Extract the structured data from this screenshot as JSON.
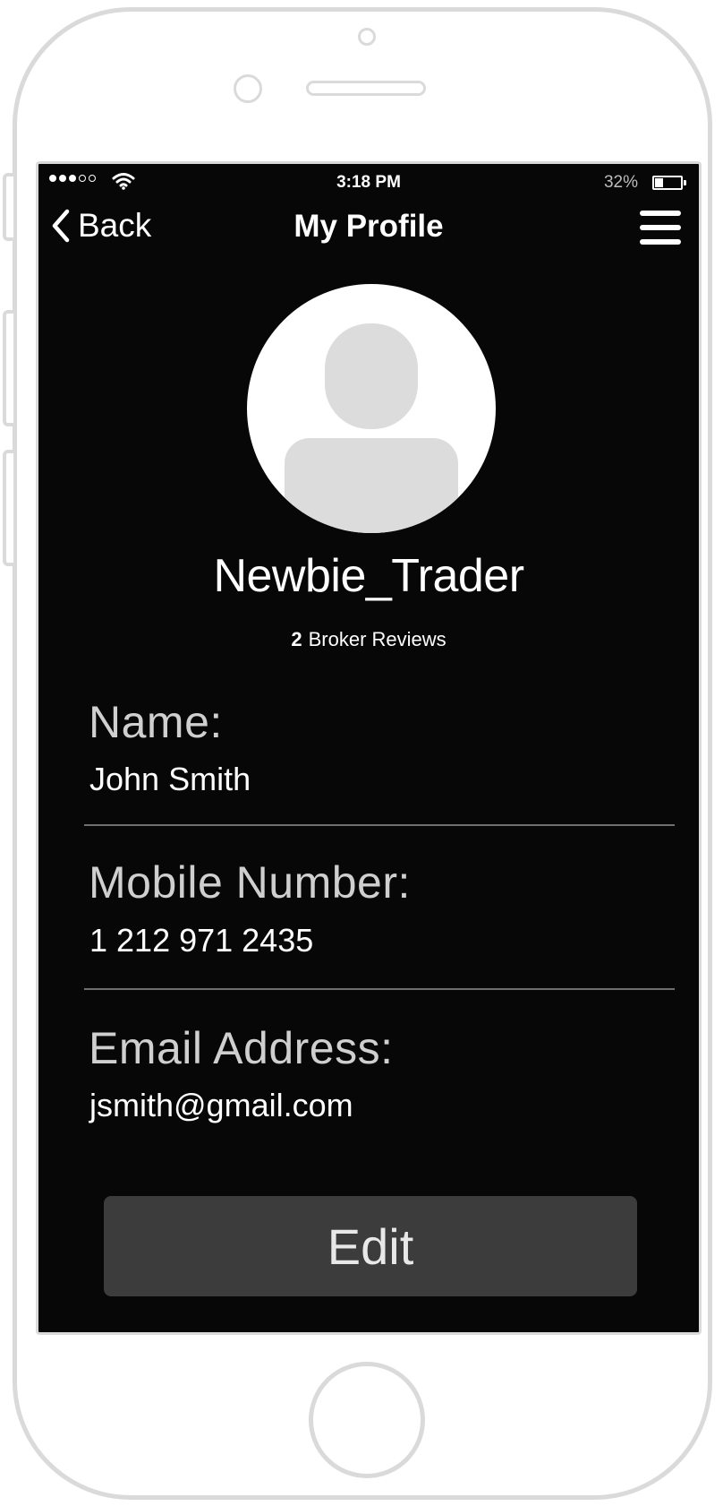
{
  "status_bar": {
    "time": "3:18 PM",
    "battery_percent": "32%",
    "battery_level": 0.32,
    "signal_bars_filled": 3,
    "signal_bars_total": 5,
    "icons": [
      "signal-dots-icon",
      "wifi-icon",
      "battery-icon"
    ]
  },
  "nav": {
    "back_label": "Back",
    "title": "My Profile",
    "icons": [
      "chevron-left-icon",
      "hamburger-menu-icon"
    ]
  },
  "profile": {
    "username": "Newbie_Trader",
    "review_count": "2",
    "review_label": "Broker Reviews",
    "avatar_icon": "user-placeholder-icon"
  },
  "fields": {
    "name": {
      "label": "Name:",
      "value": "John Smith"
    },
    "mobile": {
      "label": "Mobile  Number:",
      "value": "1 212 971 2435"
    },
    "email": {
      "label": "Email  Address:",
      "value": "jsmith@gmail.com"
    }
  },
  "actions": {
    "edit_label": "Edit"
  },
  "colors": {
    "screen_background": "#070707",
    "edit_button": "#3c3c3c",
    "divider": "#6f6f6f",
    "frame": "#dadada",
    "avatar_silhouette": "#dcdcdc"
  }
}
